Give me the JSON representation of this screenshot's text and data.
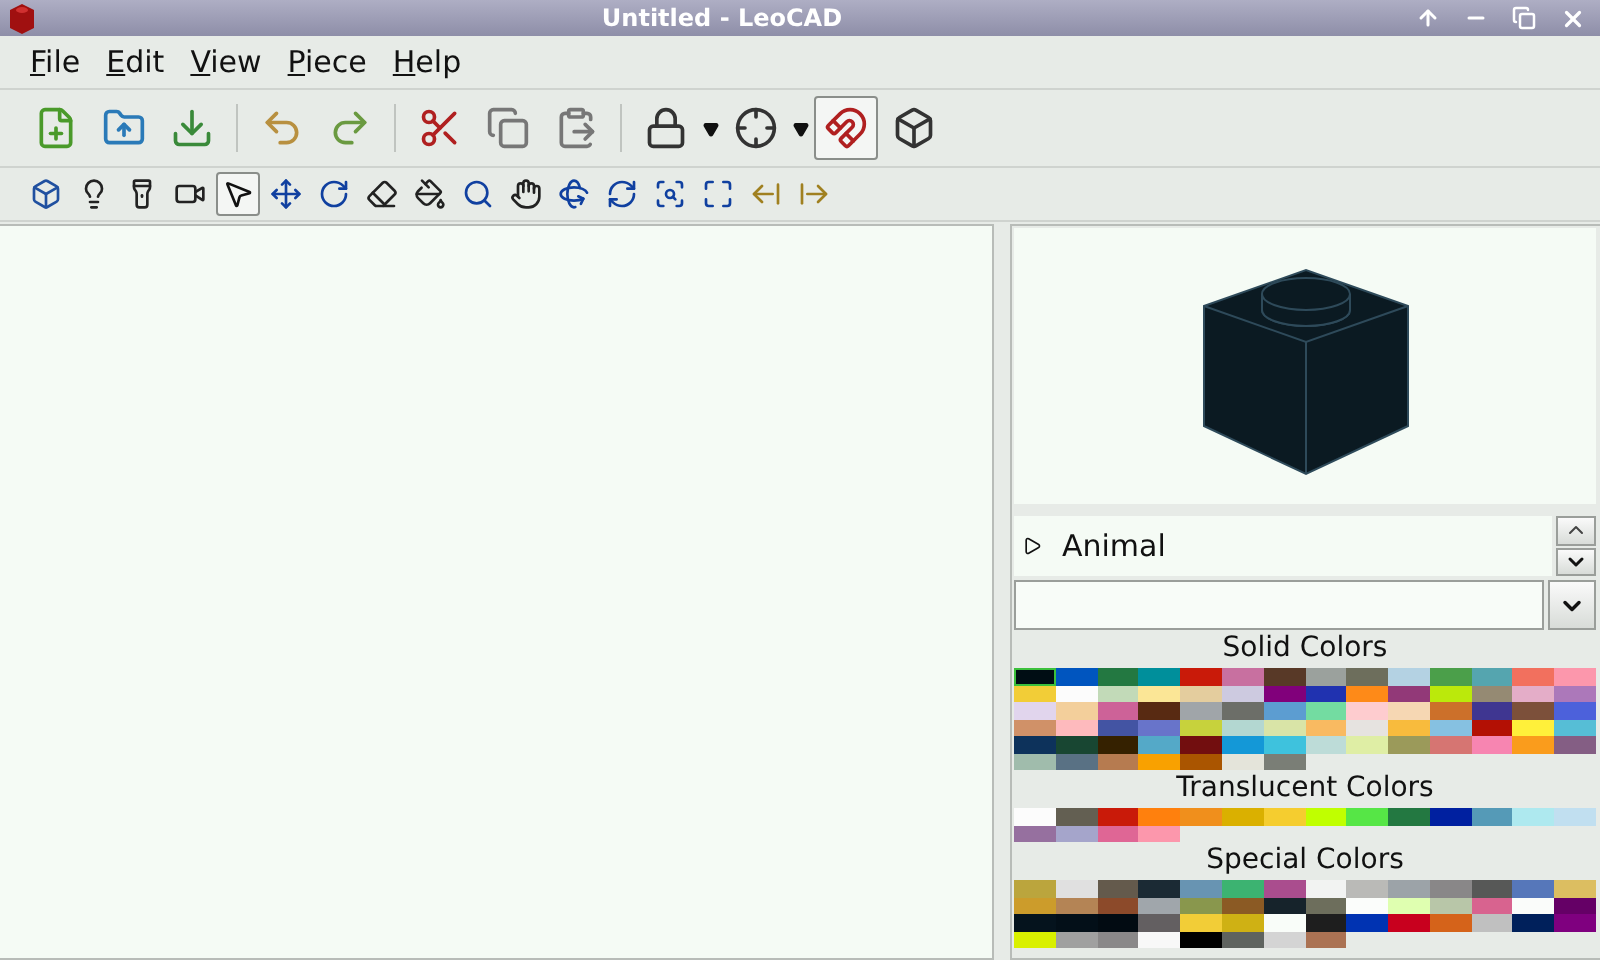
{
  "window": {
    "title": "Untitled - LeoCAD"
  },
  "menu": [
    "File",
    "Edit",
    "View",
    "Piece",
    "Help"
  ],
  "main_toolbar": [
    {
      "kind": "new",
      "pressed": false,
      "dropdown": false
    },
    {
      "kind": "open",
      "pressed": false,
      "dropdown": false
    },
    {
      "kind": "save",
      "pressed": false,
      "dropdown": false
    },
    {
      "kind": "sep"
    },
    {
      "kind": "undo",
      "pressed": false,
      "dropdown": false
    },
    {
      "kind": "redo",
      "pressed": false,
      "dropdown": false
    },
    {
      "kind": "sep"
    },
    {
      "kind": "cut",
      "pressed": false,
      "dropdown": false
    },
    {
      "kind": "copy",
      "pressed": false,
      "dropdown": false
    },
    {
      "kind": "paste",
      "pressed": false,
      "dropdown": false
    },
    {
      "kind": "sep"
    },
    {
      "kind": "lock",
      "pressed": false,
      "dropdown": true
    },
    {
      "kind": "snap",
      "pressed": false,
      "dropdown": true
    },
    {
      "kind": "magnet",
      "pressed": true,
      "dropdown": false
    },
    {
      "kind": "wire",
      "pressed": false,
      "dropdown": false
    }
  ],
  "tools": [
    {
      "kind": "brick",
      "selected": false
    },
    {
      "kind": "light",
      "selected": false
    },
    {
      "kind": "spot",
      "selected": false
    },
    {
      "kind": "camera",
      "selected": false
    },
    {
      "kind": "select",
      "selected": true
    },
    {
      "kind": "move",
      "selected": false
    },
    {
      "kind": "rotate",
      "selected": false
    },
    {
      "kind": "erase",
      "selected": false
    },
    {
      "kind": "paint",
      "selected": false
    },
    {
      "kind": "zoom",
      "selected": false
    },
    {
      "kind": "pan",
      "selected": false
    },
    {
      "kind": "orbit",
      "selected": false
    },
    {
      "kind": "roll",
      "selected": false
    },
    {
      "kind": "zoom_region",
      "selected": false
    },
    {
      "kind": "extents",
      "selected": false
    },
    {
      "kind": "prev",
      "selected": false
    },
    {
      "kind": "next",
      "selected": false
    }
  ],
  "parts_tree": [
    {
      "label": "Animal",
      "expanded": false
    }
  ],
  "color_groups": [
    {
      "title": "Solid Colors",
      "swatches": [
        {
          "color": "#000d14",
          "selected": true
        },
        {
          "color": "#0055bf",
          "selected": false
        },
        {
          "color": "#237841",
          "selected": false
        },
        {
          "color": "#008f9b",
          "selected": false
        },
        {
          "color": "#c91a09",
          "selected": false
        },
        {
          "color": "#c870a0",
          "selected": false
        },
        {
          "color": "#583927",
          "selected": false
        },
        {
          "color": "#9ba19d",
          "selected": false
        },
        {
          "color": "#6d6e5c",
          "selected": false
        },
        {
          "color": "#b4d2e3",
          "selected": false
        },
        {
          "color": "#4b9f4a",
          "selected": false
        },
        {
          "color": "#55a5af",
          "selected": false
        },
        {
          "color": "#f2705e",
          "selected": false
        },
        {
          "color": "#fc97ac",
          "selected": false
        },
        {
          "color": "#f2cd37",
          "selected": false
        },
        {
          "color": "#fcfcfc",
          "selected": false
        },
        {
          "color": "#c2dab8",
          "selected": false
        },
        {
          "color": "#fbe696",
          "selected": false
        },
        {
          "color": "#e4cd9e",
          "selected": false
        },
        {
          "color": "#cdcae0",
          "selected": false
        },
        {
          "color": "#81007b",
          "selected": false
        },
        {
          "color": "#2032b0",
          "selected": false
        },
        {
          "color": "#fe8a18",
          "selected": false
        },
        {
          "color": "#923978",
          "selected": false
        },
        {
          "color": "#bbe90b",
          "selected": false
        },
        {
          "color": "#958a73",
          "selected": false
        },
        {
          "color": "#e4adc8",
          "selected": false
        },
        {
          "color": "#ac78ba",
          "selected": false
        },
        {
          "color": "#e1d5ed",
          "selected": false
        },
        {
          "color": "#f3cf9b",
          "selected": false
        },
        {
          "color": "#cd6298",
          "selected": false
        },
        {
          "color": "#582a12",
          "selected": false
        },
        {
          "color": "#a0a5a9",
          "selected": false
        },
        {
          "color": "#6c6e68",
          "selected": false
        },
        {
          "color": "#5c9dd1",
          "selected": false
        },
        {
          "color": "#73dca1",
          "selected": false
        },
        {
          "color": "#fecccf",
          "selected": false
        },
        {
          "color": "#f6d7b3",
          "selected": false
        },
        {
          "color": "#cc702a",
          "selected": false
        },
        {
          "color": "#3f3691",
          "selected": false
        },
        {
          "color": "#7c503a",
          "selected": false
        },
        {
          "color": "#4c61db",
          "selected": false
        },
        {
          "color": "#d09168",
          "selected": false
        },
        {
          "color": "#febabd",
          "selected": false
        },
        {
          "color": "#4354a3",
          "selected": false
        },
        {
          "color": "#6874ca",
          "selected": false
        },
        {
          "color": "#c7d23c",
          "selected": false
        },
        {
          "color": "#b3d7d1",
          "selected": false
        },
        {
          "color": "#d9e4a7",
          "selected": false
        },
        {
          "color": "#f9ba61",
          "selected": false
        },
        {
          "color": "#e6e3e0",
          "selected": false
        },
        {
          "color": "#f8bb3d",
          "selected": false
        },
        {
          "color": "#86c1e1",
          "selected": false
        },
        {
          "color": "#b31004",
          "selected": false
        },
        {
          "color": "#fff03a",
          "selected": false
        },
        {
          "color": "#56bed6",
          "selected": false
        },
        {
          "color": "#0d325b",
          "selected": false
        },
        {
          "color": "#184632",
          "selected": false
        },
        {
          "color": "#352100",
          "selected": false
        },
        {
          "color": "#54a9c8",
          "selected": false
        },
        {
          "color": "#720e0f",
          "selected": false
        },
        {
          "color": "#1498d7",
          "selected": false
        },
        {
          "color": "#3ec2dd",
          "selected": false
        },
        {
          "color": "#bddcd8",
          "selected": false
        },
        {
          "color": "#dfeea5",
          "selected": false
        },
        {
          "color": "#9b9a5a",
          "selected": false
        },
        {
          "color": "#d67572",
          "selected": false
        },
        {
          "color": "#f785b1",
          "selected": false
        },
        {
          "color": "#fa9c1c",
          "selected": false
        },
        {
          "color": "#845e84",
          "selected": false
        },
        {
          "color": "#a0bcac",
          "selected": false
        },
        {
          "color": "#597184",
          "selected": false
        },
        {
          "color": "#b67b50",
          "selected": false
        },
        {
          "color": "#f9a100",
          "selected": false
        },
        {
          "color": "#aa5500",
          "selected": false
        },
        {
          "color": "#e4e4da",
          "selected": false
        },
        {
          "color": "#7a7e76",
          "selected": false
        }
      ]
    },
    {
      "title": "Translucent Colors",
      "swatches": [
        {
          "color": "#fcfcfc",
          "selected": false
        },
        {
          "color": "#635f52",
          "selected": false
        },
        {
          "color": "#c91a09",
          "selected": false
        },
        {
          "color": "#ff800d",
          "selected": false
        },
        {
          "color": "#f08f1c",
          "selected": false
        },
        {
          "color": "#dab000",
          "selected": false
        },
        {
          "color": "#f5cd2f",
          "selected": false
        },
        {
          "color": "#c0ff00",
          "selected": false
        },
        {
          "color": "#56e646",
          "selected": false
        },
        {
          "color": "#237841",
          "selected": false
        },
        {
          "color": "#0020a0",
          "selected": false
        },
        {
          "color": "#559ab7",
          "selected": false
        },
        {
          "color": "#aee9ef",
          "selected": false
        },
        {
          "color": "#c1dff0",
          "selected": false
        },
        {
          "color": "#96709f",
          "selected": false
        },
        {
          "color": "#a5a5cb",
          "selected": false
        },
        {
          "color": "#df6695",
          "selected": false
        },
        {
          "color": "#fc97ac",
          "selected": false
        }
      ]
    },
    {
      "title": "Special Colors",
      "swatches": [
        {
          "color": "#bba53d",
          "selected": false
        },
        {
          "color": "#e0e0e0",
          "selected": false
        },
        {
          "color": "#645a4c",
          "selected": false
        },
        {
          "color": "#1b2a34",
          "selected": false
        },
        {
          "color": "#6894b2",
          "selected": false
        },
        {
          "color": "#3cb371",
          "selected": false
        },
        {
          "color": "#aa4d8e",
          "selected": false
        },
        {
          "color": "#f2f3f2",
          "selected": false
        },
        {
          "color": "#babab7",
          "selected": false
        },
        {
          "color": "#9ca3a8",
          "selected": false
        },
        {
          "color": "#898788",
          "selected": false
        },
        {
          "color": "#575857",
          "selected": false
        },
        {
          "color": "#5677ba",
          "selected": false
        },
        {
          "color": "#dcbe61",
          "selected": false
        },
        {
          "color": "#cc9c2b",
          "selected": false
        },
        {
          "color": "#b48455",
          "selected": false
        },
        {
          "color": "#8c4a2a",
          "selected": false
        },
        {
          "color": "#a0a6ab",
          "selected": false
        },
        {
          "color": "#89974d",
          "selected": false
        },
        {
          "color": "#8b5a24",
          "selected": false
        },
        {
          "color": "#16232b",
          "selected": false
        },
        {
          "color": "#6d6e5c",
          "selected": false
        },
        {
          "color": "#fbfdfb",
          "selected": false
        },
        {
          "color": "#dfffb0",
          "selected": false
        },
        {
          "color": "#b8c6a8",
          "selected": false
        },
        {
          "color": "#d8638f",
          "selected": false
        },
        {
          "color": "#fafcfa",
          "selected": false
        },
        {
          "color": "#650066",
          "selected": false
        },
        {
          "color": "#05131d",
          "selected": false
        },
        {
          "color": "#030f18",
          "selected": false
        },
        {
          "color": "#020b12",
          "selected": false
        },
        {
          "color": "#635f61",
          "selected": false
        },
        {
          "color": "#f2cd37",
          "selected": false
        },
        {
          "color": "#cfb114",
          "selected": false
        },
        {
          "color": "#f9fdf9",
          "selected": false
        },
        {
          "color": "#1e1e1e",
          "selected": false
        },
        {
          "color": "#0033b2",
          "selected": false
        },
        {
          "color": "#c8001e",
          "selected": false
        },
        {
          "color": "#d5631a",
          "selected": false
        },
        {
          "color": "#c0c0c0",
          "selected": false
        },
        {
          "color": "#00205b",
          "selected": false
        },
        {
          "color": "#7f007f",
          "selected": false
        },
        {
          "color": "#d9f000",
          "selected": false
        },
        {
          "color": "#a0a0a0",
          "selected": false
        },
        {
          "color": "#8a8889",
          "selected": false
        },
        {
          "color": "#f8f8f8",
          "selected": false
        },
        {
          "color": "#000000",
          "selected": false
        },
        {
          "color": "#5f635f",
          "selected": false
        },
        {
          "color": "#d4d4d4",
          "selected": false
        },
        {
          "color": "#ab7253",
          "selected": false
        }
      ]
    }
  ]
}
